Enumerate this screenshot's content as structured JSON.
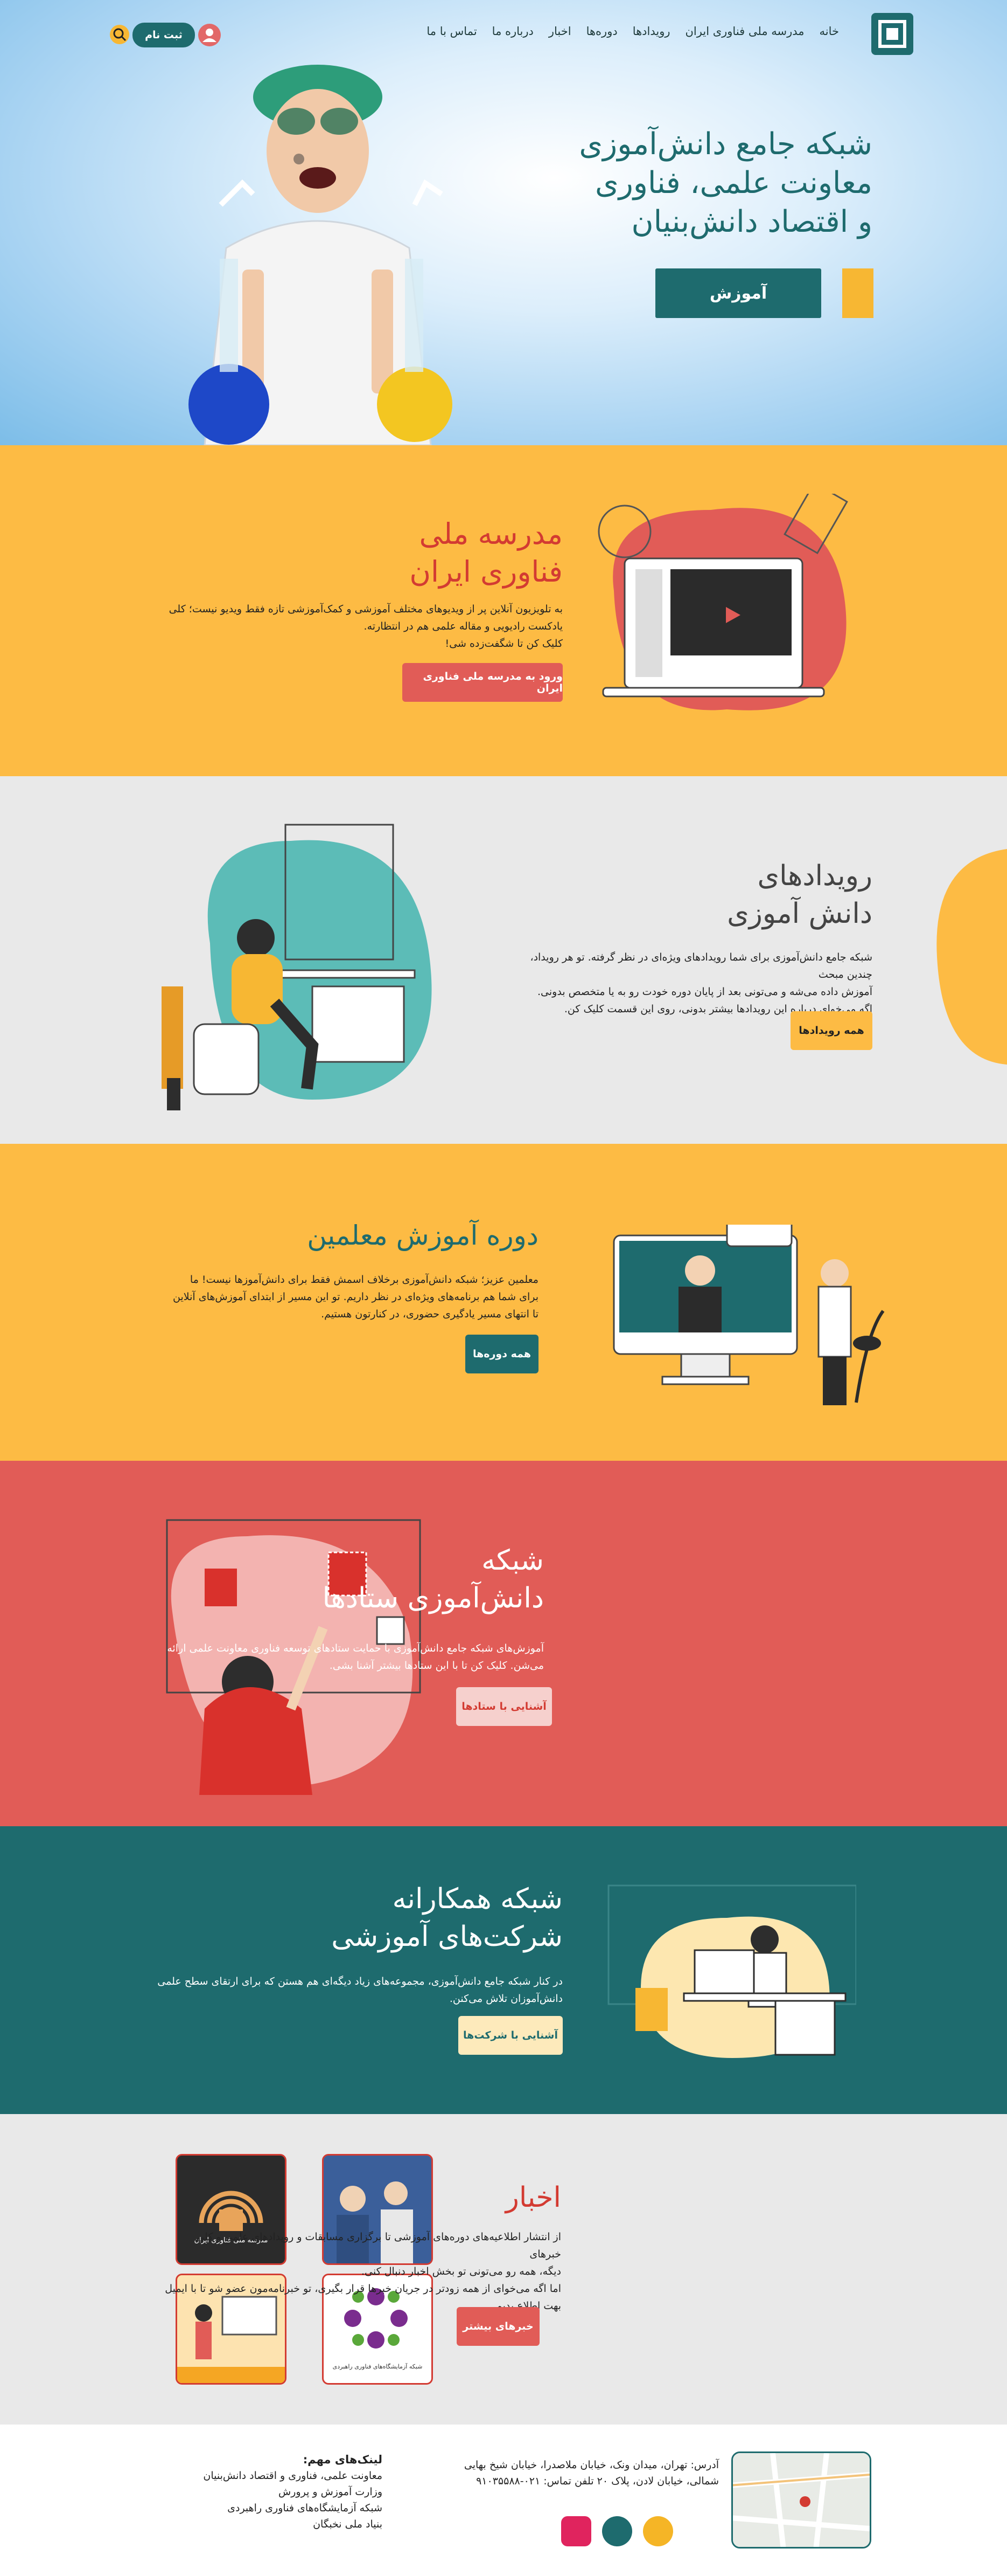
{
  "colors": {
    "teal": "#1e6b6e",
    "yellow": "#fdbb44",
    "red": "#e15c57",
    "grey": "#e9e9e9",
    "accent_red": "#d33b32"
  },
  "header": {
    "nav": [
      "خانه",
      "مدرسه ملی فناوری ایران",
      "رویدادها",
      "دوره‌ها",
      "اخبار",
      "درباره ما",
      "تماس با ما"
    ],
    "signup_label": "ثبت نام",
    "icons": {
      "logo": "site-logo",
      "user": "user-icon",
      "search": "search-icon"
    }
  },
  "hero": {
    "title_lines": [
      "شبکه جامع دانش‌آموزی",
      "معاونت علمی، فناوری",
      "و اقتصاد دانش‌بنیان"
    ],
    "button_label": "آموزش"
  },
  "school": {
    "title_lines": [
      "مدرسه ملی",
      "فناوری ایران"
    ],
    "text_lines": [
      "به تلویزیون آنلاین پر از ویدیوهای مختلف آموزشی و کمک‌آموزشی تازه فقط ویدیو نیست؛ کلی",
      "یادکست رادیویی و مقاله علمی هم در انتظارته.",
      "کلیک کن تا شگفت‌زده شی!"
    ],
    "button_label": "ورود به مدرسه ملی فناوری ایران"
  },
  "events": {
    "title_lines": [
      "رویدادهای",
      "دانش آموزی"
    ],
    "text_lines": [
      "شبکه جامع دانش‌آموزی برای شما رویدادهای ویژه‌ای در نظر گرفته. تو هر رویداد، چندین مبحث",
      "آموزش داده می‌شه و می‌تونی بعد از پایان دوره خودت رو به یا متخصص بدونی.",
      "اگه می‌خوای درباره این رویدادها بیشتر بدونی، روی این قسمت کلیک کن."
    ],
    "button_label": "همه رویدادها"
  },
  "courses": {
    "title": "دوره آموزش معلمین",
    "text_lines": [
      "معلمین عزیز؛ شبکه دانش‌آموزی برخلاف اسمش فقط برای دانش‌آموزها نیست! ما",
      "برای شما هم برنامه‌های ویژه‌ای در نظر داریم. تو این مسیر از ابتدای آموزش‌های آنلاین",
      "تا انتهای مسیر یادگیری حضوری، در کنارتون هستیم."
    ],
    "button_label": "همه دوره‌ها"
  },
  "network": {
    "title_lines": [
      "شبکه",
      "دانش‌آموزی ستادها"
    ],
    "text_lines": [
      "آموزش‌های شبکه جامع دانش‌آموزی با حمایت ستادهای توسعه فناوری معاونت علمی ارائه",
      "می‌شن. کلیک کن تا با این ستادها بیشتر آشنا بشی."
    ],
    "button_label": "آشنایی با ستادها"
  },
  "partners": {
    "title_lines": [
      "شبکه همکارانه",
      "شرکت‌های آموزشی"
    ],
    "text_lines": [
      "در کنار شبکه جامع دانش‌آموزی، مجموعه‌های زیاد دیگه‌ای هم هستن که برای ارتقای سطح علمی",
      "دانش‌آموزان تلاش می‌کنن."
    ],
    "button_label": "آشنایی با شرکت‌ها"
  },
  "news": {
    "title": "اخبار",
    "text_lines": [
      "از انتشار اطلاعیه‌های دوره‌های آموزشی تا برگزاری مسابقات و رویدادهای علمی و کلی خبرهای",
      "دیگه، همه رو می‌تونی تو بخش اخبار دنبال کنی.",
      "اما اگه می‌خوای از همه زودتر در جریان خبرها قرار بگیری، تو خبرنامه‌مون عضو شو تا با ایمیل",
      "بهت اطلاع بدیم."
    ],
    "button_label": "خبرهای بیشتر",
    "cards": [
      "مدرسه ملی فناوری ایران",
      "",
      "",
      "شبکه آزمایشگاه‌های فناوری راهبردی"
    ]
  },
  "footer": {
    "address_lines": [
      "آدرس: تهران، میدان ونک، خیابان ملاصدرا، خیابان شیخ بهایی",
      "شمالی، خیابان لادن، پلاک ۲۰ تلفن تماس: ۰۲۱-۹۱۰۳۵۵۸۸"
    ],
    "links_title": "لینک‌های مهم:",
    "links": [
      "معاونت علمی، فناوری و اقتصاد دانش‌بنیان",
      "وزارت آموزش و پرورش",
      "شبکه آزمایشگاه‌های فناوری راهبردی",
      "بنیاد ملی نخبگان"
    ],
    "social_icons": [
      "aparat-icon",
      "check-shield-icon",
      "sun-icon"
    ]
  }
}
